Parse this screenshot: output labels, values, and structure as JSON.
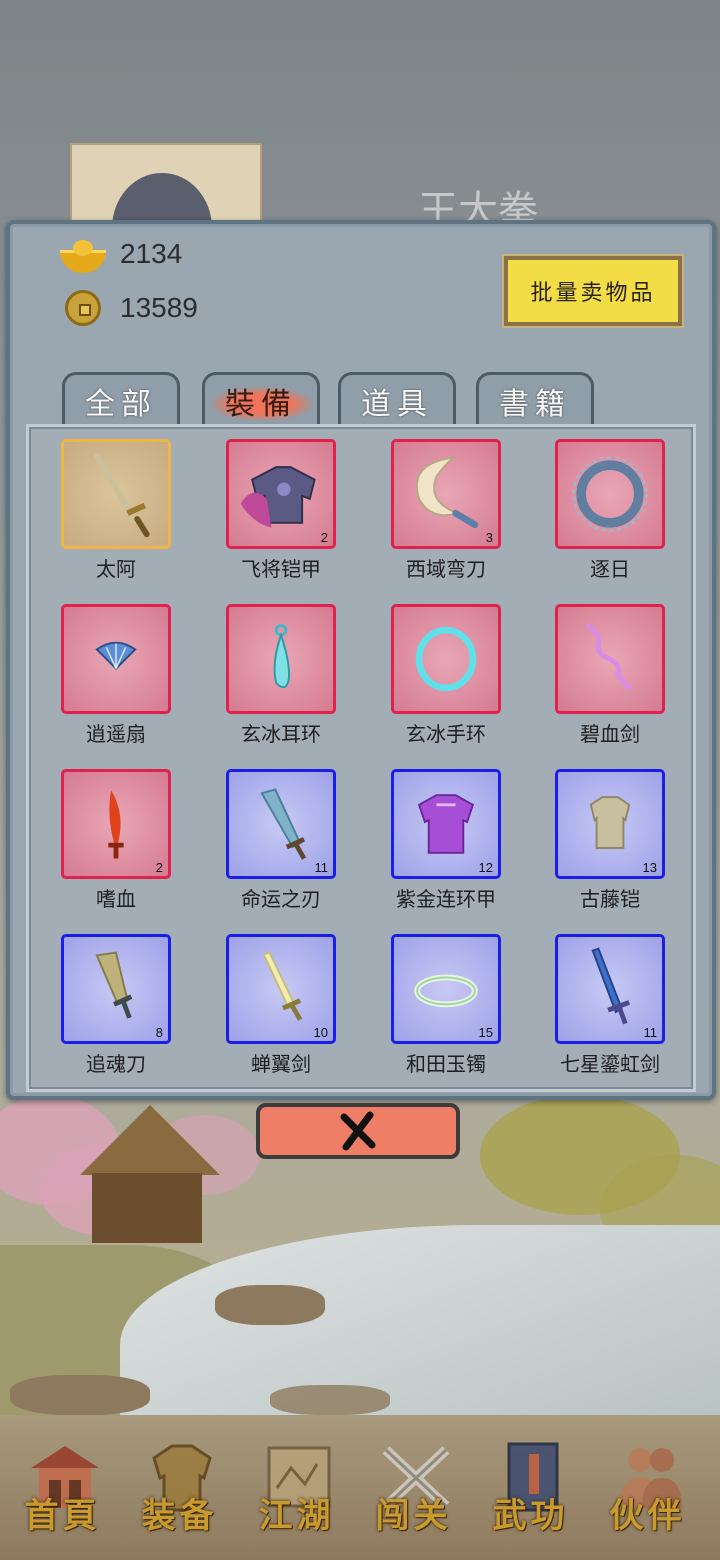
{
  "background": {
    "character_name": "王大拳"
  },
  "currency": {
    "gold_ingot": {
      "icon": "gold-ingot-icon",
      "value": "2134"
    },
    "coins": {
      "icon": "copper-coin-icon",
      "value": "13589"
    }
  },
  "sell_button_label": "批量卖物品",
  "tabs": [
    {
      "label": "全部"
    },
    {
      "label": "裝備",
      "active": true
    },
    {
      "label": "道具"
    },
    {
      "label": "書籍"
    }
  ],
  "items": [
    {
      "name": "太阿",
      "rarity": "gold",
      "icon": "sword-icon",
      "qty": ""
    },
    {
      "name": "飞将铠甲",
      "rarity": "red",
      "icon": "armor-icon",
      "qty": "2"
    },
    {
      "name": "西域弯刀",
      "rarity": "red",
      "icon": "scimitar-icon",
      "qty": "3"
    },
    {
      "name": "逐日",
      "rarity": "red",
      "icon": "chakram-icon",
      "qty": ""
    },
    {
      "name": "逍遥扇",
      "rarity": "red",
      "icon": "fan-icon",
      "qty": ""
    },
    {
      "name": "玄冰耳环",
      "rarity": "red",
      "icon": "earring-icon",
      "qty": ""
    },
    {
      "name": "玄冰手环",
      "rarity": "red",
      "icon": "bracelet-icon",
      "qty": ""
    },
    {
      "name": "碧血剑",
      "rarity": "red",
      "icon": "wavy-sword-icon",
      "qty": ""
    },
    {
      "name": "嗜血",
      "rarity": "red",
      "icon": "blood-blade-icon",
      "qty": "2"
    },
    {
      "name": "命运之刃",
      "rarity": "blue",
      "icon": "broadsword-icon",
      "qty": "11"
    },
    {
      "name": "紫金连环甲",
      "rarity": "blue",
      "icon": "chainmail-icon",
      "qty": "12"
    },
    {
      "name": "古藤铠",
      "rarity": "blue",
      "icon": "vine-armor-icon",
      "qty": "13"
    },
    {
      "name": "追魂刀",
      "rarity": "blue",
      "icon": "dagger-icon",
      "qty": "8"
    },
    {
      "name": "蝉翼剑",
      "rarity": "blue",
      "icon": "light-sword-icon",
      "qty": "10"
    },
    {
      "name": "和田玉镯",
      "rarity": "blue",
      "icon": "jade-bangle-icon",
      "qty": "15"
    },
    {
      "name": "七星鎏虹剑",
      "rarity": "blue",
      "icon": "star-sword-icon",
      "qty": "11"
    }
  ],
  "close_button": {
    "icon": "close-x-icon"
  },
  "nav": [
    {
      "label": "首頁",
      "icon": "home-pavilion-icon"
    },
    {
      "label": "装备",
      "icon": "armor-nav-icon"
    },
    {
      "label": "江湖",
      "icon": "scroll-map-icon"
    },
    {
      "label": "闯关",
      "icon": "crossed-swords-icon"
    },
    {
      "label": "武功",
      "icon": "book-icon"
    },
    {
      "label": "伙伴",
      "icon": "companions-icon"
    }
  ],
  "colors": {
    "rarity_gold": "#f0b546",
    "rarity_red": "#e0224f",
    "rarity_blue": "#1a1ee8",
    "sell_button": "#f2dd47",
    "close_button": "#ee7f66",
    "nav_label": "#c99a2e"
  }
}
